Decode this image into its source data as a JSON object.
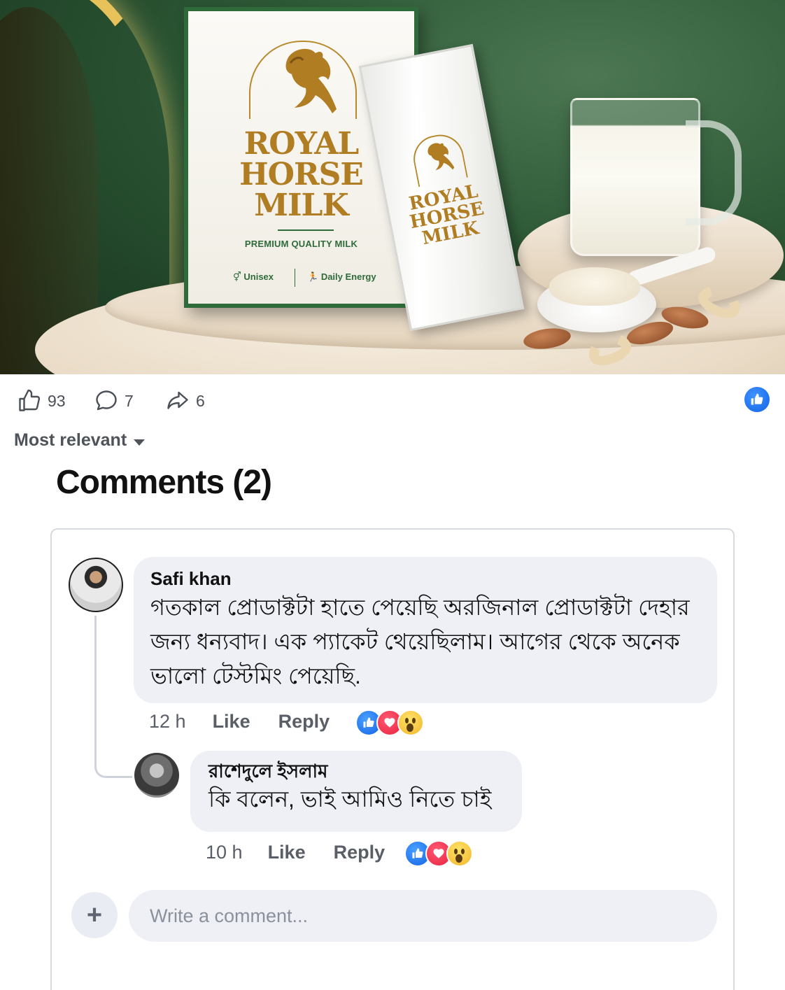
{
  "product": {
    "brand_line1": "ROYAL",
    "brand_line2": "HORSE",
    "brand_line3": "MILK",
    "tagline": "PREMIUM QUALITY MILK",
    "feature_1": "Unisex",
    "feature_2": "Daily Energy",
    "brand_color": "#b07d23",
    "accent_color": "#2f6b3a"
  },
  "stats": {
    "likes": "93",
    "comments": "7",
    "shares": "6"
  },
  "sort": {
    "label": "Most relevant"
  },
  "comments_header": {
    "title": "Comments (2)"
  },
  "comments": [
    {
      "author": "Safi khan",
      "text": "গতকাল প্রোডাক্টটা হাতে পেয়েছি অরজিনাল প্রোডাক্টটা দেহার জন্য ধন্যবাদ। এক প্যাকেট থেয়েছিলাম। আগের থেকে অনেক ভালো টেস্টমিং পেয়েছি.",
      "time": "12 h",
      "like_label": "Like",
      "reply_label": "Reply",
      "reactions": [
        "like",
        "love",
        "wow"
      ]
    },
    {
      "author": "রাশেদুলে ইসলাম",
      "text": "কি বলেন, ভাই আমিও নিতে চাই",
      "time": "10 h",
      "like_label": "Like",
      "reply_label": "Reply",
      "reactions": [
        "like",
        "love",
        "wow"
      ]
    }
  ],
  "composer": {
    "placeholder": "Write a comment...",
    "add_icon": "+"
  },
  "colors": {
    "facebook_blue": "#1263e6",
    "bubble_bg": "#eef0f6"
  }
}
